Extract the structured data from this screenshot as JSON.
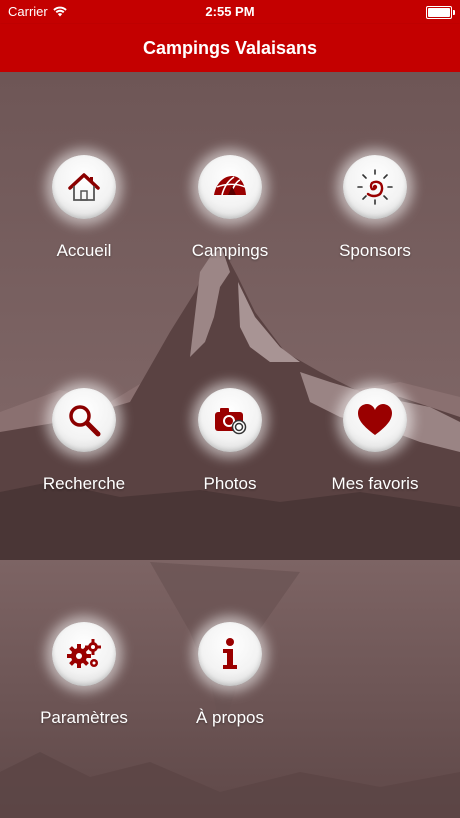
{
  "status_bar": {
    "carrier": "Carrier",
    "time": "2:55 PM"
  },
  "nav_bar": {
    "title": "Campings Valaisans"
  },
  "menu": [
    {
      "label": "Accueil",
      "icon": "house-icon"
    },
    {
      "label": "Campings",
      "icon": "tent-icon"
    },
    {
      "label": "Sponsors",
      "icon": "sun-spiral-icon"
    },
    {
      "label": "Recherche",
      "icon": "magnifier-icon"
    },
    {
      "label": "Photos",
      "icon": "camera-icon"
    },
    {
      "label": "Mes favoris",
      "icon": "heart-icon"
    },
    {
      "label": "Paramètres",
      "icon": "gears-icon"
    },
    {
      "label": "À propos",
      "icon": "info-icon"
    }
  ],
  "colors": {
    "brand_red": "#c40000",
    "icon_red": "#8b0000"
  }
}
